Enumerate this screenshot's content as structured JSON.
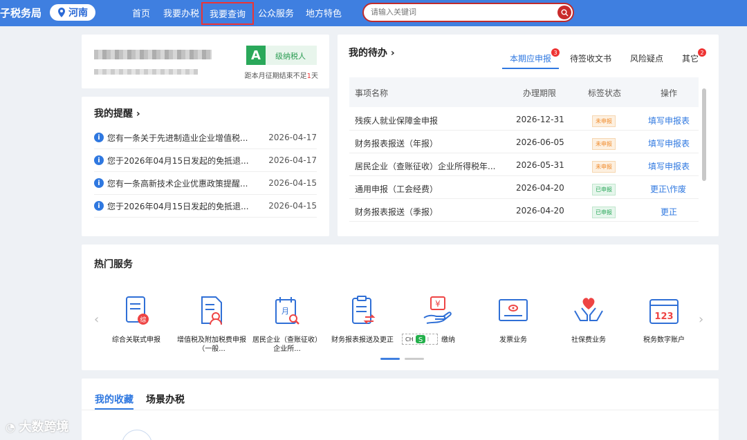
{
  "header": {
    "site_title": "子税务局",
    "region": "河南",
    "nav": [
      "首页",
      "我要办税",
      "我要查询",
      "公众服务",
      "地方特色"
    ],
    "search_placeholder": "请输入关键词"
  },
  "profile": {
    "grade": "A",
    "grade_label": "级纳税人",
    "deadline_prefix": "距本月征期结束不足",
    "deadline_days": "1",
    "deadline_suffix": "天"
  },
  "reminders": {
    "title": "我的提醒",
    "items": [
      {
        "text": "您有一条关于先进制造业企业增值税...",
        "date": "2026-04-17"
      },
      {
        "text": "您于2026年04月15日发起的免抵退...",
        "date": "2026-04-17"
      },
      {
        "text": "您有一条高新技术企业优惠政策提醒...",
        "date": "2026-04-15"
      },
      {
        "text": "您于2026年04月15日发起的免抵退...",
        "date": "2026-04-15"
      }
    ]
  },
  "todo": {
    "title": "我的待办",
    "tabs": [
      {
        "label": "本期应申报",
        "badge": "3"
      },
      {
        "label": "待签收文书",
        "badge": ""
      },
      {
        "label": "风险疑点",
        "badge": ""
      },
      {
        "label": "其它",
        "badge": "2"
      }
    ],
    "columns": [
      "事项名称",
      "办理期限",
      "标签状态",
      "操作"
    ],
    "rows": [
      {
        "name": "残疾人就业保障金申报",
        "deadline": "2026-12-31",
        "status": "未申报",
        "status_type": "todo",
        "action": "填写申报表"
      },
      {
        "name": "财务报表报送（年报）",
        "deadline": "2026-06-05",
        "status": "未申报",
        "status_type": "todo",
        "action": "填写申报表"
      },
      {
        "name": "居民企业（查账征收）企业所得税年...",
        "deadline": "2026-05-31",
        "status": "未申报",
        "status_type": "todo",
        "action": "填写申报表"
      },
      {
        "name": "通用申报（工会经费）",
        "deadline": "2026-04-20",
        "status": "已申报",
        "status_type": "done",
        "action": "更正\\作废"
      },
      {
        "name": "财务报表报送（季报）",
        "deadline": "2026-04-20",
        "status": "已申报",
        "status_type": "done",
        "action": "更正"
      }
    ]
  },
  "services": {
    "title": "热门服务",
    "items": [
      {
        "label": "综合关联式申报",
        "icon": "comprehensive-declaration-icon"
      },
      {
        "label": "增值税及附加税费申报（一般...",
        "icon": "vat-declaration-icon"
      },
      {
        "label": "居民企业（查账征收）企业所...",
        "icon": "enterprise-income-tax-icon"
      },
      {
        "label": "财务报表报送及更正",
        "icon": "financial-report-icon"
      },
      {
        "label": "缴纳",
        "icon": "tax-payment-icon"
      },
      {
        "label": "发票业务",
        "icon": "invoice-icon"
      },
      {
        "label": "社保费业务",
        "icon": "social-insurance-icon"
      },
      {
        "label": "税务数字账户",
        "icon": "digital-account-icon"
      }
    ]
  },
  "ime": {
    "label": "CH"
  },
  "favorites": {
    "tabs": [
      "我的收藏",
      "场景办税"
    ]
  },
  "watermark": "大数跨境",
  "colors": {
    "brand": "#3f7fe0",
    "accent_blue": "#2f78e0",
    "alert_red": "#e33333"
  }
}
